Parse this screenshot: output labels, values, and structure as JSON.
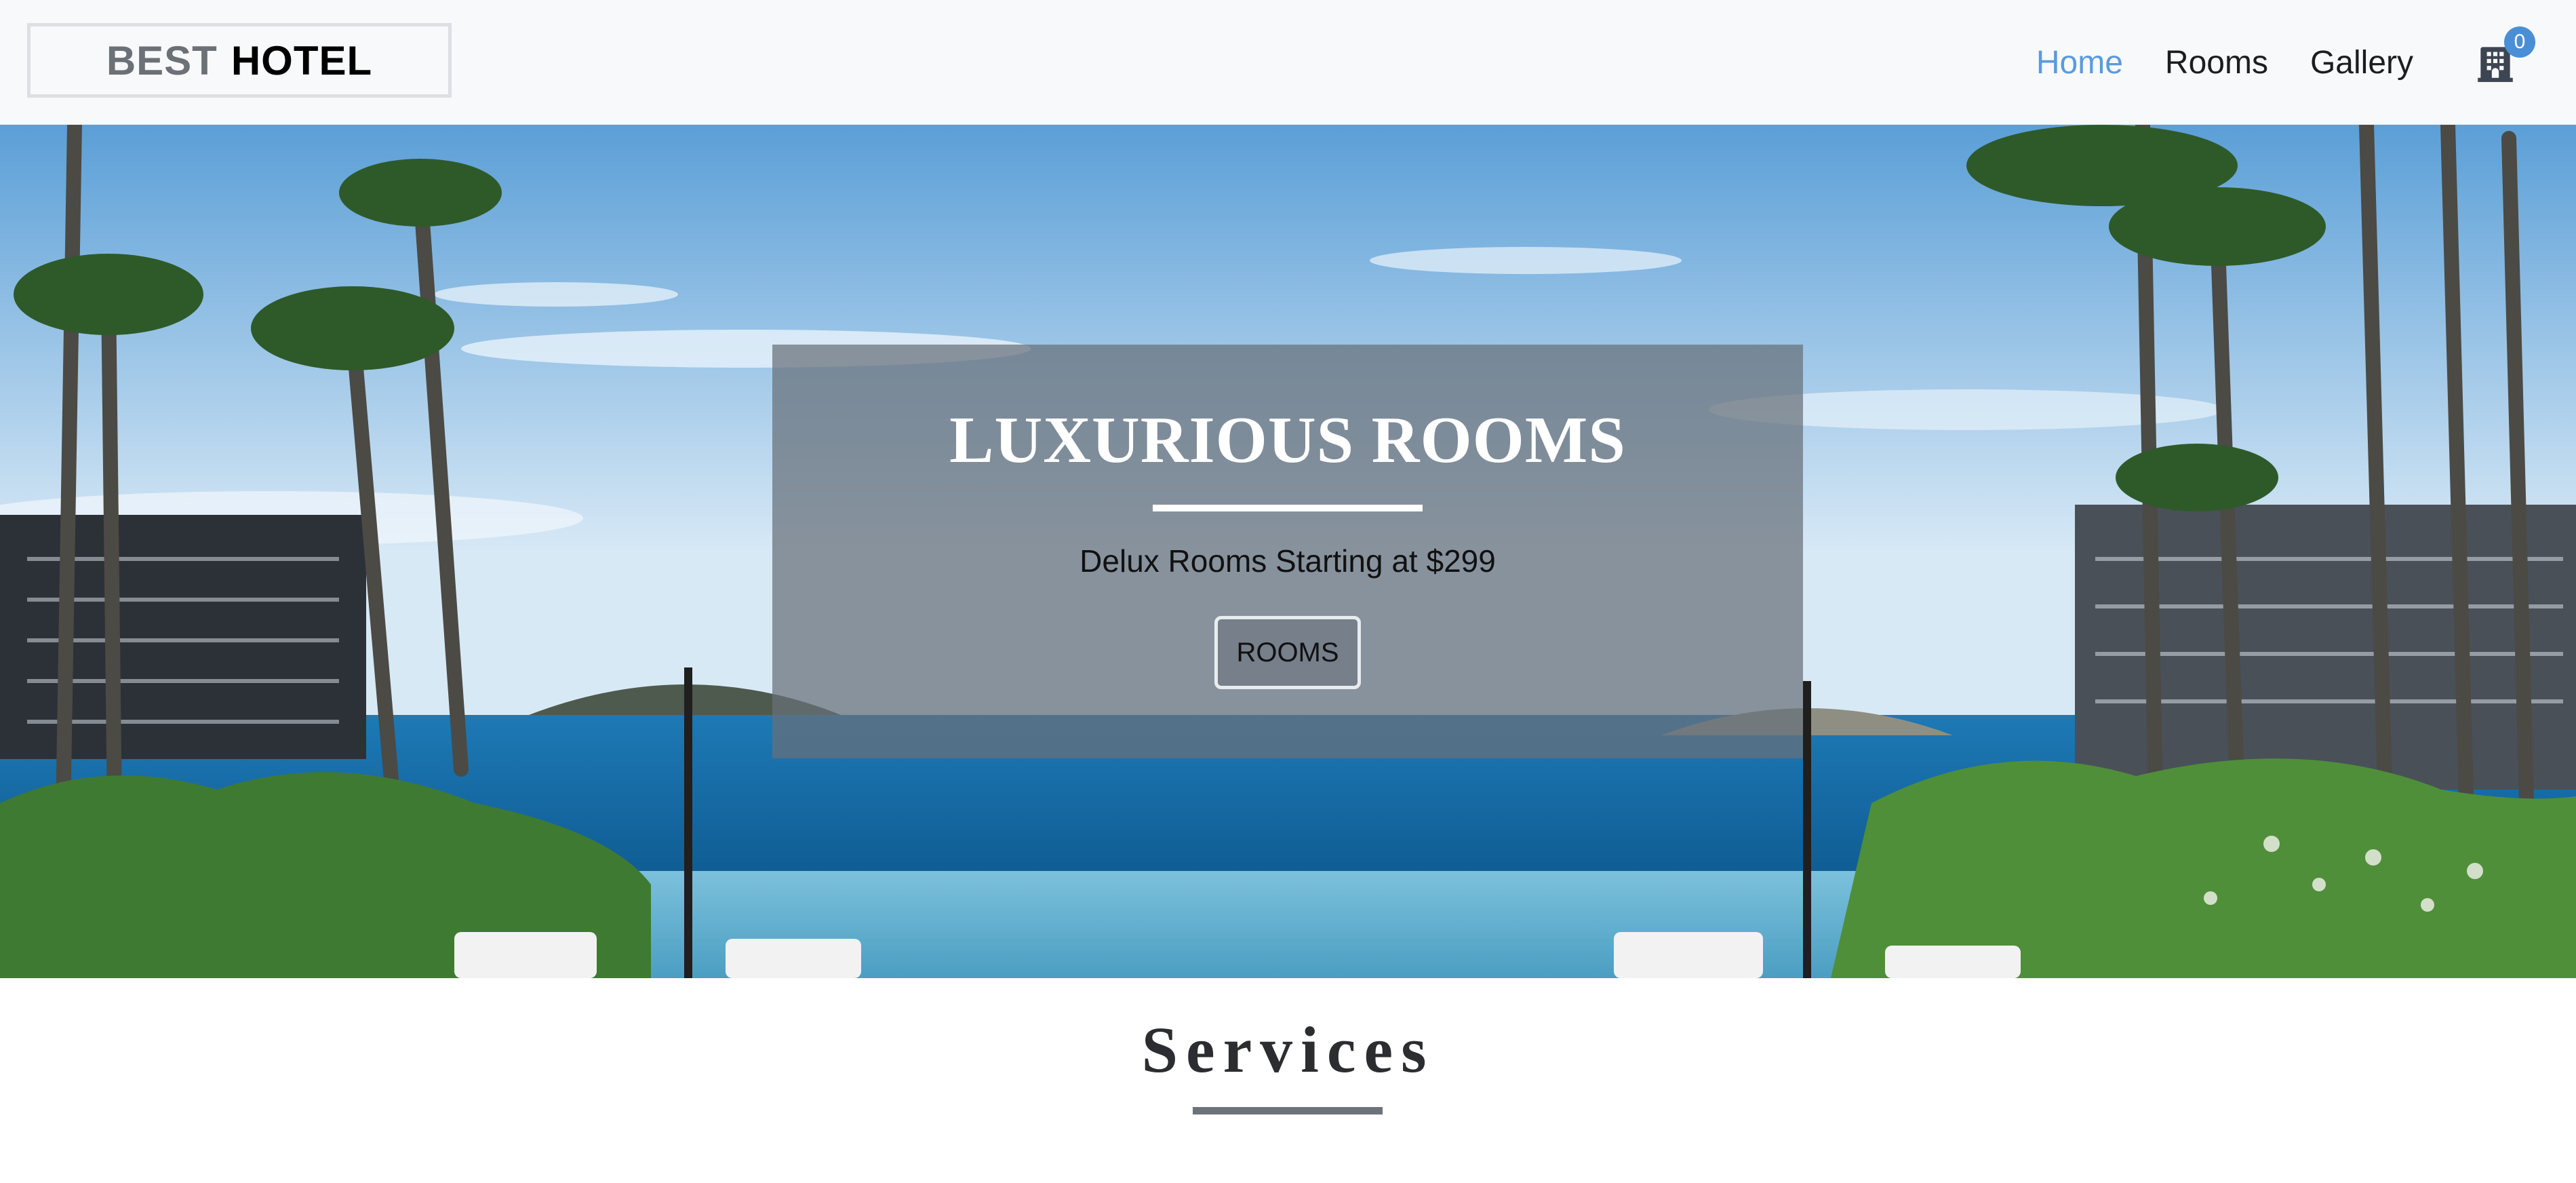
{
  "navbar": {
    "logo_part1": "BEST",
    "logo_part2": "HOTEL",
    "links": [
      {
        "label": "Home",
        "active": true
      },
      {
        "label": "Rooms",
        "active": false
      },
      {
        "label": "Gallery",
        "active": false
      }
    ],
    "cart_icon": "hotel-building-icon",
    "cart_count": "0"
  },
  "hero": {
    "title": "LUXURIOUS ROOMS",
    "subtitle": "Delux Rooms Starting at $299",
    "button_label": "ROOMS"
  },
  "services": {
    "title": "Services"
  },
  "colors": {
    "accent": "#5a9ae0",
    "badge": "#4a8fd6",
    "banner_overlay": "#68707a",
    "navbar_bg": "#f8f9fa"
  }
}
